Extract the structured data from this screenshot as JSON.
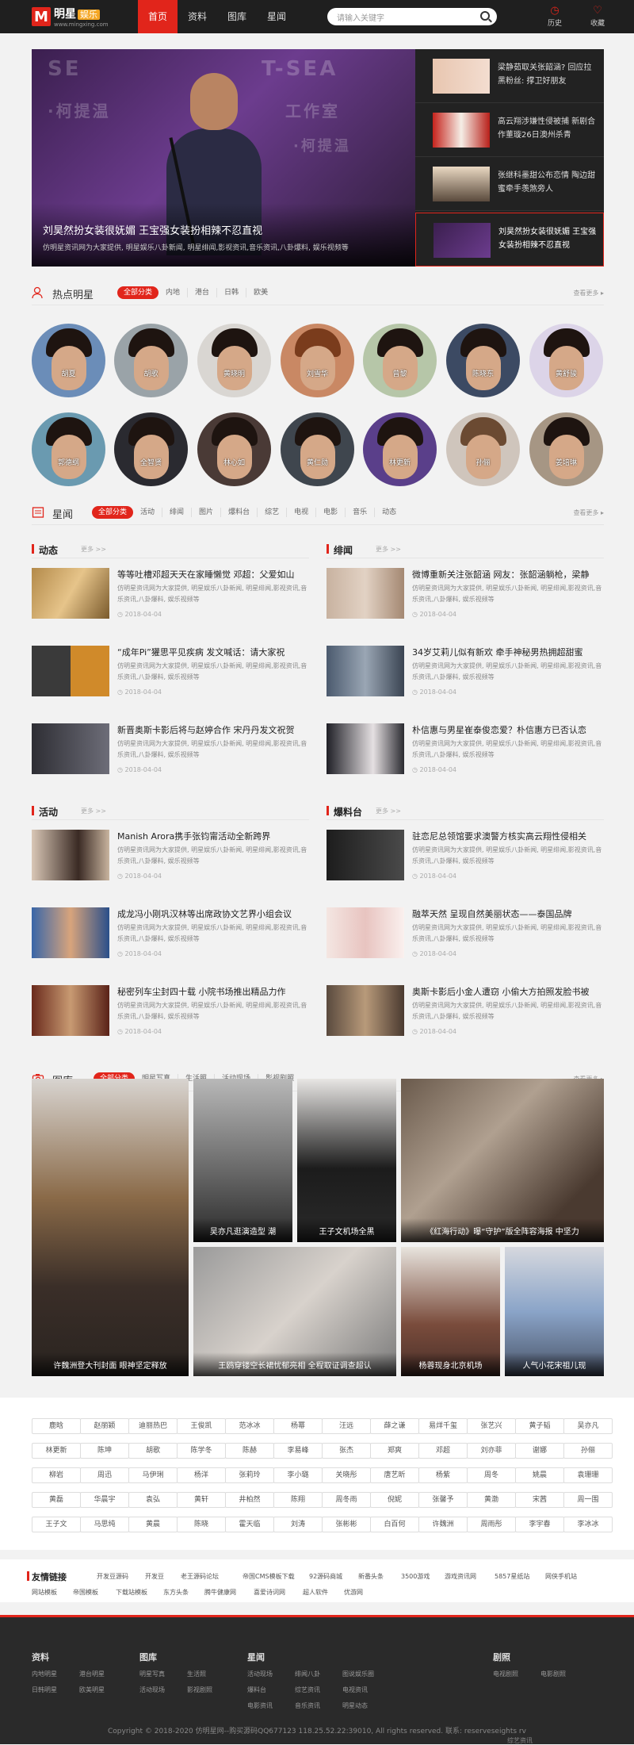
{
  "header": {
    "logo_letter": "M",
    "logo_name": "明星",
    "logo_tag": "娱乐",
    "logo_url": "www.mingxing.com",
    "nav": [
      "首页",
      "资料",
      "图库",
      "星闻"
    ],
    "search_placeholder": "请输入关键字",
    "history_label": "历史",
    "favorite_label": "收藏"
  },
  "hero": {
    "bg_words": [
      "SE",
      "T-SEA",
      "·柯提温",
      "工作室",
      "·柯提温"
    ],
    "title": "刘昊然扮女装很妩媚 王宝强女装扮相辣不忍直视",
    "desc": "仿明星资讯网为大家提供, 明星娱乐八卦新闻, 明星绯闻,影视资讯,音乐资讯,八卦爆料, 娱乐视频等",
    "side": [
      "梁静茹取关张韶涵? 回应拉黑粉丝: 撑卫好朋友",
      "高云翔涉嫌性侵被捕 新剧合作董璇26日澳州杀青",
      "张继科墨甜公布恋情 陶边甜蜜牵手羡煞旁人",
      "刘昊然扮女装很妩媚 王宝强女装扮相辣不忍直视"
    ]
  },
  "hot_stars": {
    "title": "热点明星",
    "tabs": [
      "全部分类",
      "内地",
      "港台",
      "日韩",
      "欧美"
    ],
    "more": "查看更多 ▸",
    "names": [
      "胡夏",
      "胡歌",
      "黄晓明",
      "刘雪华",
      "曾黎",
      "陈晓东",
      "黄舒骏",
      "郭德纲",
      "全智贤",
      "林心如",
      "黄仁勋",
      "林更新",
      "孙俪",
      "姜培琳"
    ]
  },
  "news": {
    "title": "星闻",
    "tabs": [
      "全部分类",
      "活动",
      "绯闻",
      "图片",
      "爆料台",
      "综艺",
      "电视",
      "电影",
      "音乐",
      "动态"
    ],
    "more": "查看更多 ▸",
    "sub_more": "更多 >>",
    "desc": "仿明星资讯网为大家提供, 明星娱乐八卦新闻, 明星绯闻,影视资讯,音乐资讯,八卦爆料, 娱乐视频等",
    "date": "2018-04-04",
    "columns": [
      {
        "title": "动态",
        "items": [
          "等等吐槽邓超天天在家睡懒觉 邓超：父爱如山",
          "“成年Pi”獾思平见疾病 发文喊话：请大家祝",
          "新晋奥斯卡影后将与赵婷合作 宋丹丹发文祝贺"
        ]
      },
      {
        "title": "绯闻",
        "items": [
          "微博重新关注张韶涵 网友：张韶涵躺枪，梁静",
          "34岁艾莉儿似有新欢 牵手神秘男热拥超甜蜜",
          "朴信惠与男星崔泰俊恋爱？朴信惠方已否认恋"
        ]
      },
      {
        "title": "活动",
        "items": [
          "Manish Arora携手张钧甯活动全新跨界",
          "成龙冯小刚巩汉林等出席政协文艺界小组会议",
          "秘密列车尘封四十载 小院书场推出精品力作"
        ]
      },
      {
        "title": "爆料台",
        "items": [
          "驻恋尼总领馆要求澳警方核实高云翔性侵相关",
          "融萃天然 呈现自然美丽状态——泰国品牌",
          "奥斯卡影后小金人遭窃 小偷大方拍照发脸书被"
        ]
      }
    ]
  },
  "gallery": {
    "title": "图库",
    "tabs": [
      "全部分类",
      "明星写真",
      "生活照",
      "活动现场",
      "影视剧照"
    ],
    "more": "查看更多 ▸",
    "items": [
      "许魏洲登大刊封面 眼神坚定释放",
      "吴亦凡逛演造型 潮",
      "王子文机场全黑",
      "《红海行动》曝“守护”版全阵容海报 中坚力",
      "王鸥穿镂空长裙忧郁亮相 全程取证调查超认",
      "杨蓉现身北京机场",
      "人气小花宋祖儿现"
    ]
  },
  "tags": [
    "鹿晗",
    "赵丽颖",
    "迪丽热巴",
    "王俊凯",
    "范冰冰",
    "杨幂",
    "汪远",
    "薛之谦",
    "易烊千玺",
    "张艺兴",
    "黄子韬",
    "吴亦凡",
    "林更新",
    "陈坤",
    "胡歌",
    "陈学冬",
    "陈赫",
    "李易峰",
    "张杰",
    "郑爽",
    "邓超",
    "刘亦菲",
    "谢娜",
    "孙俪",
    "柳岩",
    "周迅",
    "马伊琍",
    "杨洋",
    "张莉玲",
    "李小璐",
    "关晓彤",
    "唐艺昕",
    "杨紫",
    "周冬",
    "姚晨",
    "袁珊珊",
    "黄磊",
    "华晨宇",
    "袁弘",
    "黄轩",
    "井柏然",
    "陈翔",
    "周冬雨",
    "倪妮",
    "张馨予",
    "黄渤",
    "宋茜",
    "周一围",
    "王子文",
    "马思纯",
    "黄晨",
    "陈晓",
    "霍天临",
    "刘涛",
    "张彬彬",
    "白百何",
    "许魏洲",
    "周雨彤",
    "李宇春",
    "李冰冰"
  ],
  "friend_links": {
    "title": "友情链接",
    "row1": [
      "开发豆源码",
      "开发豆",
      "老王源码论坛",
      "帝国CMS模板下载",
      "92源码商城",
      "新番头条",
      "3500游戏",
      "游戏资讯网",
      "5857星纸站",
      "网侠手机站"
    ],
    "row2": [
      "网站模板",
      "帝国模板",
      "下载站模板",
      "东方头条",
      "腾牛健康网",
      "喜爱诗词网",
      "超人软件",
      "优游网"
    ]
  },
  "footer": {
    "columns": [
      {
        "title": "资料",
        "links": [
          "内地明星",
          "港台明星",
          "日韩明星",
          "欧美明星"
        ]
      },
      {
        "title": "图库",
        "links": [
          "明星写真",
          "生活照",
          "活动现场",
          "影视剧照"
        ]
      },
      {
        "title": "星闻",
        "links": [
          "活动现场",
          "绯闻八卦",
          "图说娱乐圈",
          "爆料台",
          "综艺资讯",
          "电视资讯",
          "电影资讯",
          "音乐资讯",
          "明星动态"
        ]
      },
      {
        "title": "剧照",
        "links": [
          "电视剧照",
          "电影剧照"
        ]
      }
    ],
    "copyright": "Copyright © 2018-2020 仿明星网--购买源码QQ677123 118.25.52.22:39010, All rights reserved.  联系: reserveseights rv",
    "copyright_extra": "综艺资讯"
  },
  "colors": {
    "accent": "#e1251b",
    "topbar": "#1f1f1f",
    "footer": "#2a2a2a"
  }
}
